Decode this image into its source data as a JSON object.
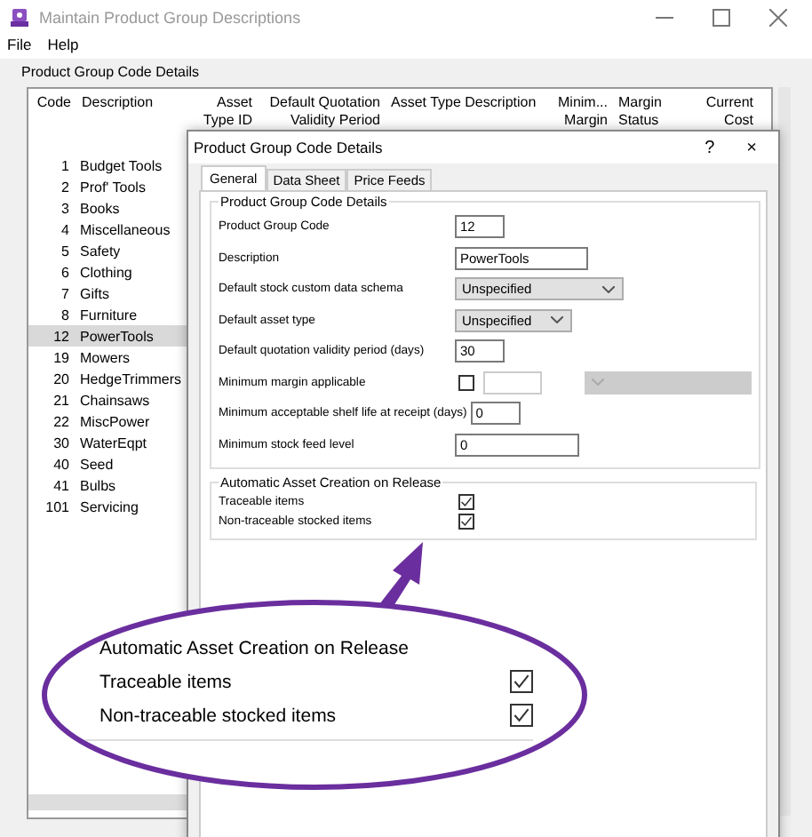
{
  "window": {
    "title": "Maintain Product Group Descriptions"
  },
  "menu": [
    "File",
    "Help"
  ],
  "group_title": "Product Group Code Details",
  "table": {
    "columns": [
      "Code",
      "Description",
      "Asset Type ID",
      "Default Quotation Validity Period",
      "Asset Type Description",
      "Minim... Margin",
      "Margin Status",
      "Current Cost"
    ],
    "rows": [
      {
        "code": "1",
        "description": "Budget Tools",
        "selected": false
      },
      {
        "code": "2",
        "description": "Prof' Tools",
        "selected": false
      },
      {
        "code": "3",
        "description": "Books",
        "selected": false
      },
      {
        "code": "4",
        "description": "Miscellaneous",
        "selected": false
      },
      {
        "code": "5",
        "description": "Safety",
        "selected": false
      },
      {
        "code": "6",
        "description": "Clothing",
        "selected": false
      },
      {
        "code": "7",
        "description": "Gifts",
        "selected": false
      },
      {
        "code": "8",
        "description": "Furniture",
        "selected": false
      },
      {
        "code": "12",
        "description": "PowerTools",
        "selected": true
      },
      {
        "code": "19",
        "description": "Mowers",
        "selected": false
      },
      {
        "code": "20",
        "description": "HedgeTrimmers",
        "selected": false
      },
      {
        "code": "21",
        "description": "Chainsaws",
        "selected": false
      },
      {
        "code": "22",
        "description": "MiscPower",
        "selected": false
      },
      {
        "code": "30",
        "description": "WaterEqpt",
        "selected": false
      },
      {
        "code": "40",
        "description": "Seed",
        "selected": false
      },
      {
        "code": "41",
        "description": "Bulbs",
        "selected": false
      },
      {
        "code": "101",
        "description": "Servicing",
        "selected": false
      }
    ]
  },
  "dialog": {
    "title": "Product Group Code Details",
    "help": "?",
    "close": "×",
    "tabs": [
      {
        "label": "General",
        "selected": true
      },
      {
        "label": "Data Sheet",
        "selected": false
      },
      {
        "label": "Price Feeds",
        "selected": false
      }
    ],
    "details": {
      "title": "Product Group Code Details",
      "fields": [
        {
          "label": "Product Group Code",
          "kind": "text",
          "value": "12"
        },
        {
          "label": "Description",
          "kind": "text",
          "value": "PowerTools"
        },
        {
          "label": "Default stock custom data schema",
          "kind": "select",
          "value": "Unspecified"
        },
        {
          "label": "Default asset type",
          "kind": "select",
          "value": "Unspecified"
        },
        {
          "label": "Default quotation validity period (days)",
          "kind": "text",
          "value": "30"
        },
        {
          "label": "Minimum margin applicable",
          "kind": "margin",
          "checked": false
        },
        {
          "label": "Minimum acceptable shelf life at receipt (days)",
          "kind": "text",
          "value": "0"
        },
        {
          "label": "Minimum stock feed level",
          "kind": "text",
          "value": "0"
        }
      ]
    },
    "release": {
      "title": "Automatic Asset Creation on Release",
      "items": [
        {
          "label": "Traceable items",
          "checked": true
        },
        {
          "label": "Non-traceable stocked items",
          "checked": true
        }
      ]
    }
  },
  "callout": {
    "title": "Automatic Asset Creation on Release",
    "items": [
      {
        "label": "Traceable items",
        "checked": true
      },
      {
        "label": "Non-traceable stocked items",
        "checked": true
      }
    ]
  }
}
